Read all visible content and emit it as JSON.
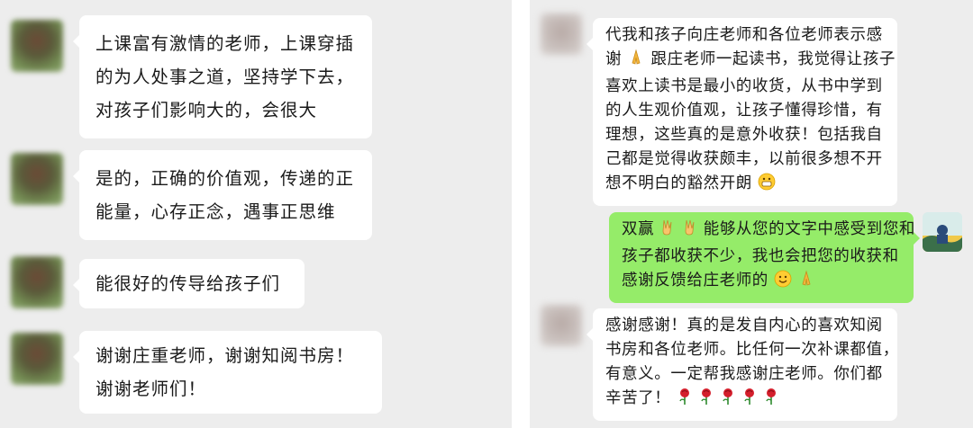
{
  "left_chat": {
    "messages": [
      {
        "lines": [
          "上课富有激情的老师，上课穿插",
          "的为人处事之道，坚持学下去，",
          "对孩子们影响大的，会很大"
        ]
      },
      {
        "lines": [
          "是的，正确的价值观，传递的正",
          "能量，心存正念，遇事正思维"
        ]
      },
      {
        "lines": [
          "能很好的传导给孩子们"
        ]
      },
      {
        "lines": [
          "谢谢庄重老师，谢谢知阅书房！",
          "谢谢老师们！"
        ]
      }
    ]
  },
  "right_chat": {
    "messages": [
      {
        "lines": [
          "代我和孩子向庄老师和各位老师表示感",
          "谢",
          "跟庄老师一起读书，我觉得让孩子",
          "喜欢上读书是最小的收货，从书中学到",
          "的人生观价值观，让孩子懂得珍惜，有",
          "理想，这些真的是意外收获！包括我自",
          "己都是觉得收获颇丰，以前很多想不开",
          "想不明白的豁然开朗"
        ]
      },
      {
        "lines": [
          "双赢",
          "能够从您的文字中感受到您和",
          "孩子都收获不少，我也会把您的收获和",
          "感谢反馈给庄老师的"
        ]
      },
      {
        "lines": [
          "感谢感谢！真的是发自内心的喜欢知阅",
          "书房和各位老师。比任何一次补课都值，",
          "有意义。一定帮我感谢庄老师。你们都",
          "辛苦了！"
        ]
      }
    ]
  },
  "colors": {
    "chat_bg": "#ededed",
    "incoming_bubble": "#ffffff",
    "outgoing_bubble": "#95ec69"
  },
  "icons": [
    "pray-emoji",
    "grin-emoji",
    "victory-hand-emoji",
    "smile-emoji",
    "rose-emoji"
  ]
}
